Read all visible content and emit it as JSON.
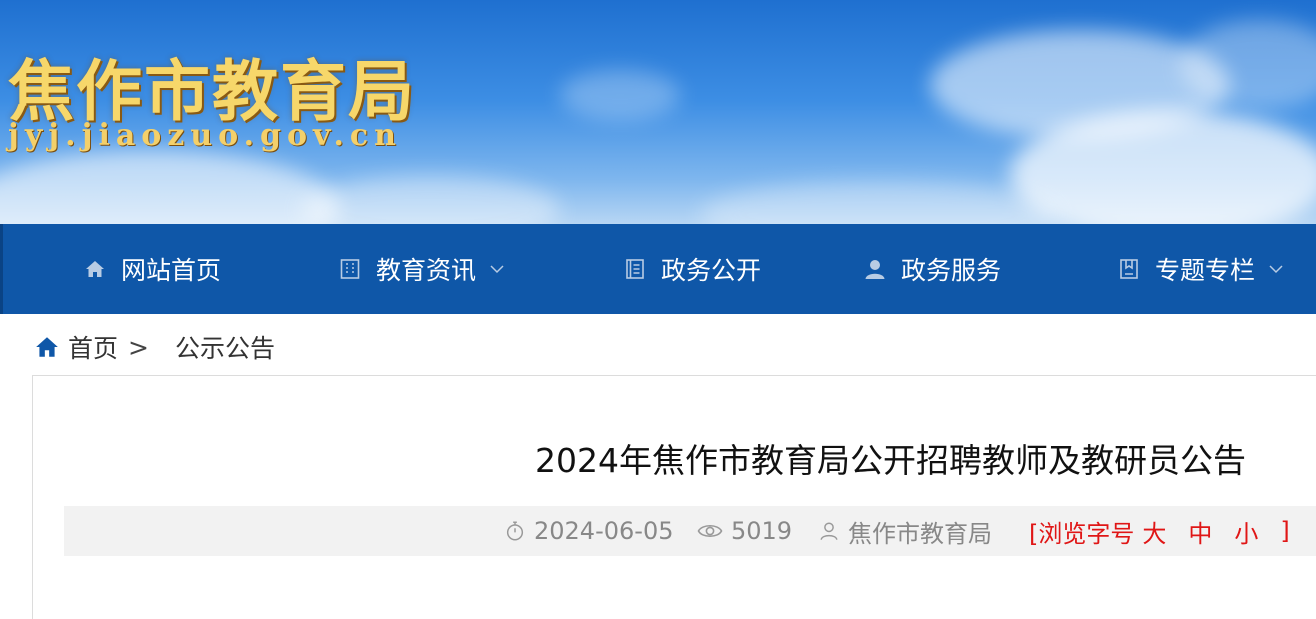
{
  "banner": {
    "title": "焦作市教育局",
    "domain": "jyj.jiaozuo.gov.cn"
  },
  "nav": {
    "items": [
      {
        "label": "网站首页",
        "icon": "home-icon",
        "has_dropdown": false
      },
      {
        "label": "教育资讯",
        "icon": "building-icon",
        "has_dropdown": true
      },
      {
        "label": "政务公开",
        "icon": "document-icon",
        "has_dropdown": false
      },
      {
        "label": "政务服务",
        "icon": "user-icon",
        "has_dropdown": false
      },
      {
        "label": "专题专栏",
        "icon": "bookmark-icon",
        "has_dropdown": true
      }
    ]
  },
  "breadcrumb": {
    "home_label": "首页",
    "separator": ">",
    "current": "公示公告"
  },
  "article": {
    "title": "2024年焦作市教育局公开招聘教师及教研员公告",
    "date": "2024-06-05",
    "views": "5019",
    "author": "焦作市教育局",
    "font_size": {
      "open": "[浏览字号",
      "large": "大",
      "medium": "中",
      "small": "小",
      "close": "]"
    }
  },
  "colors": {
    "nav_bg": "#0f57a8",
    "banner_title": "#f7d76a",
    "font_size_ctrl": "#e01616",
    "meta_text": "#888888"
  }
}
